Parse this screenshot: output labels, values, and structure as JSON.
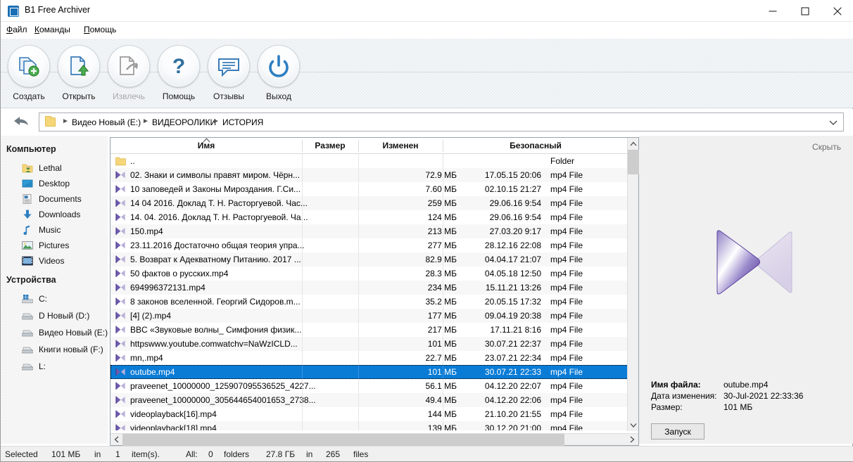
{
  "window": {
    "title": "B1 Free Archiver",
    "icon": "app-icon",
    "controls": {
      "minimize": "minimize-icon",
      "maximize": "maximize-icon",
      "close": "close-icon"
    }
  },
  "menu": [
    {
      "label": "Файл",
      "accel": "Ф"
    },
    {
      "label": "Команды",
      "accel": "К"
    },
    {
      "label": "Помощь",
      "accel": "П"
    }
  ],
  "toolbar": [
    {
      "label": "Создать",
      "icon": "create-archive-icon",
      "disabled": false
    },
    {
      "label": "Открыть",
      "icon": "open-archive-icon",
      "disabled": false
    },
    {
      "label": "Извлечь",
      "icon": "extract-icon",
      "disabled": true
    },
    {
      "label": "Помощь",
      "icon": "help-question-icon",
      "disabled": false
    },
    {
      "label": "Отзывы",
      "icon": "feedback-icon",
      "disabled": false
    },
    {
      "label": "Выход",
      "icon": "power-exit-icon",
      "disabled": false
    }
  ],
  "address": {
    "back_icon": "back-arrow-icon",
    "folder_icon": "folder-icon",
    "chevron_icon": "chevron-down-icon",
    "crumbs": [
      "Видео Новый (E:)",
      "ВИДЕОРОЛИКИ",
      "ИСТОРИЯ"
    ]
  },
  "sidebar": {
    "groups": [
      {
        "title": "Компьютер",
        "items": [
          {
            "label": "Lethal",
            "icon": "user-folder-icon"
          },
          {
            "label": "Desktop",
            "icon": "desktop-icon"
          },
          {
            "label": "Documents",
            "icon": "documents-icon"
          },
          {
            "label": "Downloads",
            "icon": "downloads-icon"
          },
          {
            "label": "Music",
            "icon": "music-icon"
          },
          {
            "label": "Pictures",
            "icon": "pictures-icon"
          },
          {
            "label": "Videos",
            "icon": "videos-icon"
          }
        ]
      },
      {
        "title": "Устройства",
        "items": [
          {
            "label": "C:",
            "icon": "system-drive-icon"
          },
          {
            "label": "D Новый (D:)",
            "icon": "drive-icon"
          },
          {
            "label": "Видео Новый (E:)",
            "icon": "drive-icon"
          },
          {
            "label": "Книги новый (F:)",
            "icon": "drive-icon"
          },
          {
            "label": "L:",
            "icon": "drive-icon"
          }
        ]
      }
    ]
  },
  "filelist": {
    "columns": [
      "Имя",
      "Размер",
      "Изменен",
      "Безопасный"
    ],
    "sort_column": "Имя",
    "sort_indicator": "sort-asc-icon",
    "rows": [
      {
        "name": "..",
        "size": "",
        "date": "",
        "secure": "Folder",
        "icon": "folder-icon",
        "selected": false
      },
      {
        "name": "02. Знаки и символы правят миром. Чёрн...",
        "size": "72.9 МБ",
        "date": "17.05.15 20:06",
        "secure": "mp4 File",
        "icon": "video-file-icon",
        "selected": false
      },
      {
        "name": "10 заповедей и Законы Мироздания. Г.Си...",
        "size": "7.60 МБ",
        "date": "02.10.15 21:27",
        "secure": "mp4 File",
        "icon": "video-file-icon",
        "selected": false
      },
      {
        "name": "14 04 2016. Доклад Т. Н. Расторгуевой. Час...",
        "size": "259 МБ",
        "date": "29.06.16 9:54",
        "secure": "mp4 File",
        "icon": "video-file-icon",
        "selected": false
      },
      {
        "name": "14. 04. 2016. Доклад Т. Н. Расторгуевой. Ча...",
        "size": "124 МБ",
        "date": "29.06.16 9:54",
        "secure": "mp4 File",
        "icon": "video-file-icon",
        "selected": false
      },
      {
        "name": "150.mp4",
        "size": "213 МБ",
        "date": "27.03.20 9:17",
        "secure": "mp4 File",
        "icon": "video-file-icon",
        "selected": false
      },
      {
        "name": "23.11.2016 Достаточно общая теория упра...",
        "size": "277 МБ",
        "date": "28.12.16 22:08",
        "secure": "mp4 File",
        "icon": "video-file-icon",
        "selected": false
      },
      {
        "name": "5. Возврат к Адекватному Питанию. 2017 ...",
        "size": "82.9 МБ",
        "date": "04.04.17 21:07",
        "secure": "mp4 File",
        "icon": "video-file-icon",
        "selected": false
      },
      {
        "name": "50 фактов о русских.mp4",
        "size": "28.3 МБ",
        "date": "04.05.18 12:50",
        "secure": "mp4 File",
        "icon": "video-file-icon",
        "selected": false
      },
      {
        "name": "694996372131.mp4",
        "size": "234 МБ",
        "date": "15.11.21 13:26",
        "secure": "mp4 File",
        "icon": "video-file-icon",
        "selected": false
      },
      {
        "name": "8 законов вселенной. Георгий Сидоров.m...",
        "size": "35.2 МБ",
        "date": "20.05.15 17:32",
        "secure": "mp4 File",
        "icon": "video-file-icon",
        "selected": false
      },
      {
        "name": "[4] (2).mp4",
        "size": "177 МБ",
        "date": "09.04.19 20:38",
        "secure": "mp4 File",
        "icon": "video-file-icon",
        "selected": false
      },
      {
        "name": "BBC «Звуковые волны_ Симфония физик...",
        "size": "217 МБ",
        "date": "17.11.21 8:16",
        "secure": "mp4 File",
        "icon": "video-file-icon",
        "selected": false
      },
      {
        "name": "httpswww.youtube.comwatchv=NaWzICLD...",
        "size": "101 МБ",
        "date": "30.07.21 22:37",
        "secure": "mp4 File",
        "icon": "video-file-icon",
        "selected": false
      },
      {
        "name": "mn,.mp4",
        "size": "22.7 МБ",
        "date": "23.07.21 22:34",
        "secure": "mp4 File",
        "icon": "video-file-icon",
        "selected": false
      },
      {
        "name": "outube.mp4",
        "size": "101 МБ",
        "date": "30.07.21 22:33",
        "secure": "mp4 File",
        "icon": "video-file-icon",
        "selected": true
      },
      {
        "name": "praveenet_10000000_125907095536525_4227...",
        "size": "56.1 МБ",
        "date": "04.12.20 22:07",
        "secure": "mp4 File",
        "icon": "video-file-icon",
        "selected": false
      },
      {
        "name": "praveenet_10000000_305644654001653_2738...",
        "size": "49.4 МБ",
        "date": "04.12.20 22:06",
        "secure": "mp4 File",
        "icon": "video-file-icon",
        "selected": false
      },
      {
        "name": "videoplayback[16].mp4",
        "size": "144 МБ",
        "date": "21.10.20 21:55",
        "secure": "mp4 File",
        "icon": "video-file-icon",
        "selected": false
      },
      {
        "name": "videoplayback[18].mp4",
        "size": "139 МБ",
        "date": "30.12.20 21:00",
        "secure": "mp4 File",
        "icon": "video-file-icon",
        "selected": false
      }
    ]
  },
  "preview": {
    "hide_label": "Скрыть",
    "thumbnail_icon": "kmplayer-video-icon",
    "fields": [
      {
        "key": "Имя файла:",
        "value": "outube.mp4",
        "bold": true
      },
      {
        "key": "Дата изменения:",
        "value": "30-Jul-2021 22:33:36",
        "bold": false
      },
      {
        "key": "Размер:",
        "value": "101 МБ",
        "bold": false
      }
    ],
    "run_button": "Запуск"
  },
  "status": {
    "selected_label": "Selected",
    "selected_size": "101 МБ",
    "in_label": "in",
    "selected_count": "1",
    "items_label": "item(s).",
    "all_label": "All:",
    "folders_count": "0",
    "folders_label": "folders",
    "total_size": "27.8 ГБ",
    "in_label2": "in",
    "files_count": "265",
    "files_label": "files"
  },
  "colors": {
    "selection": "#0a7cd6",
    "toolbar_blue": "#2f7fc1",
    "accent_green": "#3e9b3e",
    "folder_yellow": "#f5d77a",
    "kmplayer_purple": "#5b3f9e"
  }
}
